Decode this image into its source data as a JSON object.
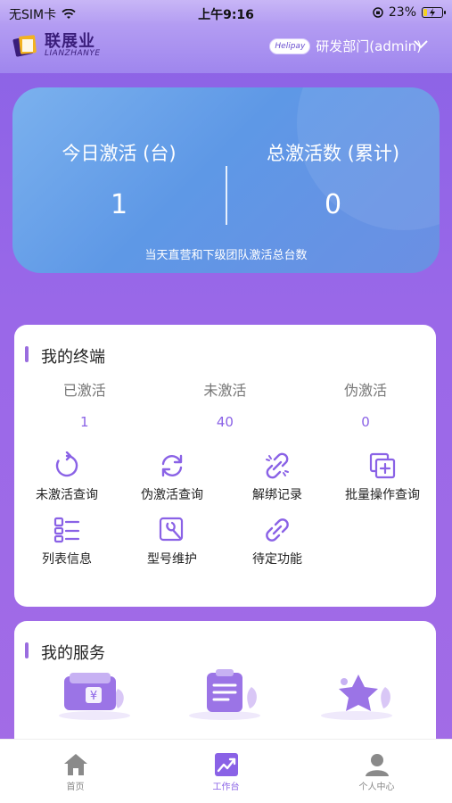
{
  "status_bar": {
    "carrier": "无SIM卡",
    "time": "上午9:16",
    "battery_pct": "23%",
    "battery_level": 0.23
  },
  "header": {
    "logo_cn": "联展业",
    "logo_en": "LIANZHANYE",
    "badge": "Helipay",
    "department": "研发部门(admin)"
  },
  "stats": {
    "today_label": "今日激活 (台)",
    "today_value": "1",
    "total_label": "总激活数 (累计)",
    "total_value": "0",
    "note": "当天直营和下级团队激活总台数"
  },
  "terminal": {
    "title": "我的终端",
    "stats": [
      {
        "label": "已激活",
        "value": "1"
      },
      {
        "label": "未激活",
        "value": "40"
      },
      {
        "label": "伪激活",
        "value": "0"
      }
    ],
    "actions": [
      {
        "label": "未激活查询",
        "icon": "refresh-circle-icon"
      },
      {
        "label": "伪激活查询",
        "icon": "sync-icon"
      },
      {
        "label": "解绑记录",
        "icon": "unlink-icon"
      },
      {
        "label": "批量操作查询",
        "icon": "batch-add-icon"
      },
      {
        "label": "列表信息",
        "icon": "list-icon"
      },
      {
        "label": "型号维护",
        "icon": "wrench-icon"
      },
      {
        "label": "待定功能",
        "icon": "link-icon"
      }
    ]
  },
  "services": {
    "title": "我的服务",
    "items": [
      {
        "icon": "wallet-icon"
      },
      {
        "icon": "clipboard-icon"
      },
      {
        "icon": "star-icon"
      }
    ]
  },
  "tabbar": {
    "tabs": [
      {
        "label": "首页",
        "icon": "home-icon",
        "active": false
      },
      {
        "label": "工作台",
        "icon": "chart-icon",
        "active": true
      },
      {
        "label": "个人中心",
        "icon": "user-icon",
        "active": false
      }
    ]
  },
  "colors": {
    "accent": "#8a62e6",
    "card_blue": "#6a9fe8",
    "battery": "#f4d21e"
  }
}
